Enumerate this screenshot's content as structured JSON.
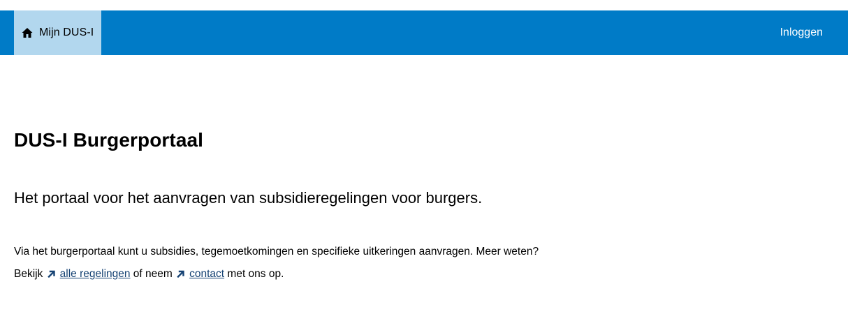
{
  "header": {
    "home_label": "Mijn DUS-I",
    "home_icon": "home-icon",
    "login_label": "Inloggen",
    "bar_color": "#007bc7",
    "home_tab_color": "#b2d7ee"
  },
  "main": {
    "title": "DUS-I Burgerportaal",
    "lead": "Het portaal voor het aanvragen van subsidieregelingen voor burgers.",
    "body": {
      "text_1": "Via het burgerportaal kunt u subsidies, tegemoetkomingen en specifieke uitkeringen aanvragen. Meer we­ten? Bekijk",
      "link_1": "alle regelingen",
      "text_2": " of neem",
      "link_2": "contact",
      "text_3": " met ons op.",
      "link_icon": "external-link-arrow-icon",
      "link_color": "#154273"
    }
  }
}
